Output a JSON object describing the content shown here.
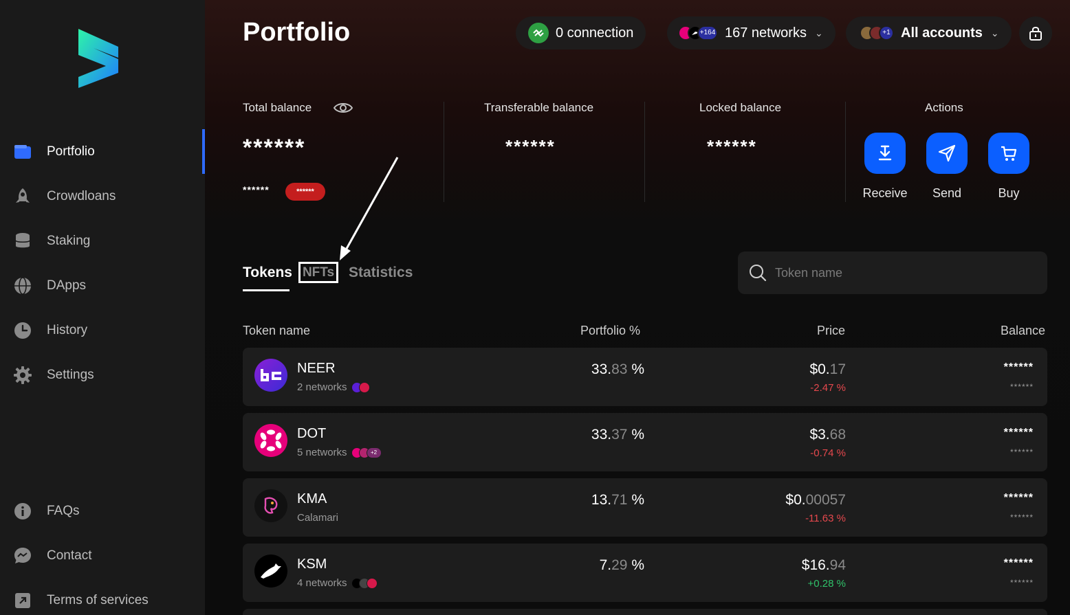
{
  "sidebar": {
    "nav": [
      {
        "label": "Portfolio",
        "icon": "wallet-icon"
      },
      {
        "label": "Crowdloans",
        "icon": "rocket-icon"
      },
      {
        "label": "Staking",
        "icon": "database-icon"
      },
      {
        "label": "DApps",
        "icon": "globe-icon"
      },
      {
        "label": "History",
        "icon": "clock-icon"
      },
      {
        "label": "Settings",
        "icon": "gear-icon"
      }
    ],
    "footer": [
      {
        "label": "FAQs",
        "icon": "info-icon"
      },
      {
        "label": "Contact",
        "icon": "chat-icon"
      },
      {
        "label": "Terms of services",
        "icon": "external-link-icon"
      }
    ]
  },
  "header": {
    "title": "Portfolio",
    "connection": "0 connection",
    "networks": "167 networks",
    "networks_badge": "+164",
    "accounts": "All accounts",
    "accounts_badge": "+1"
  },
  "balances": {
    "total_label": "Total balance",
    "total_value": "******",
    "total_sub": "******",
    "total_badge": "******",
    "transferable_label": "Transferable balance",
    "transferable_value": "******",
    "locked_label": "Locked balance",
    "locked_value": "******",
    "actions_label": "Actions"
  },
  "actions": {
    "receive": "Receive",
    "send": "Send",
    "buy": "Buy"
  },
  "tabs": {
    "tokens": "Tokens",
    "nfts": "NFTs",
    "statistics": "Statistics"
  },
  "search": {
    "placeholder": "Token name"
  },
  "table": {
    "headers": {
      "name": "Token name",
      "portfolio": "Portfolio %",
      "price": "Price",
      "balance": "Balance"
    },
    "rows": [
      {
        "name": "NEER",
        "sub": "2 networks",
        "pct_main": "33.",
        "pct_dim": "83",
        "pct_unit": " %",
        "price_main": "$0.",
        "price_dim": "17",
        "change": "-2.47 %",
        "change_color": "#e5484d",
        "bal1": "******",
        "bal2": "******",
        "icon_bg": "#5a1fd6"
      },
      {
        "name": "DOT",
        "sub": "5 networks",
        "pct_main": "33.",
        "pct_dim": "37",
        "pct_unit": " %",
        "price_main": "$3.",
        "price_dim": "68",
        "change": "-0.74 %",
        "change_color": "#e5484d",
        "bal1": "******",
        "bal2": "******",
        "icon_bg": "#e6007a",
        "mini_badge": "+2"
      },
      {
        "name": "KMA",
        "sub": "Calamari",
        "pct_main": "13.",
        "pct_dim": "71",
        "pct_unit": " %",
        "price_main": "$0.",
        "price_dim": "00057",
        "change": "-11.63 %",
        "change_color": "#e5484d",
        "bal1": "******",
        "bal2": "******",
        "icon_bg": "#111111"
      },
      {
        "name": "KSM",
        "sub": "4 networks",
        "pct_main": "7.",
        "pct_dim": "29",
        "pct_unit": " %",
        "price_main": "$16.",
        "price_dim": "94",
        "change": "+0.28 %",
        "change_color": "#30c26a",
        "bal1": "******",
        "bal2": "******",
        "icon_bg": "#000000"
      }
    ]
  },
  "colors": {
    "accent": "#0b5fff",
    "active_indicator": "#2f6bff",
    "negative": "#e5484d",
    "positive": "#30c26a",
    "connection_green": "#2ea043",
    "badge_red": "#c41e1e"
  }
}
